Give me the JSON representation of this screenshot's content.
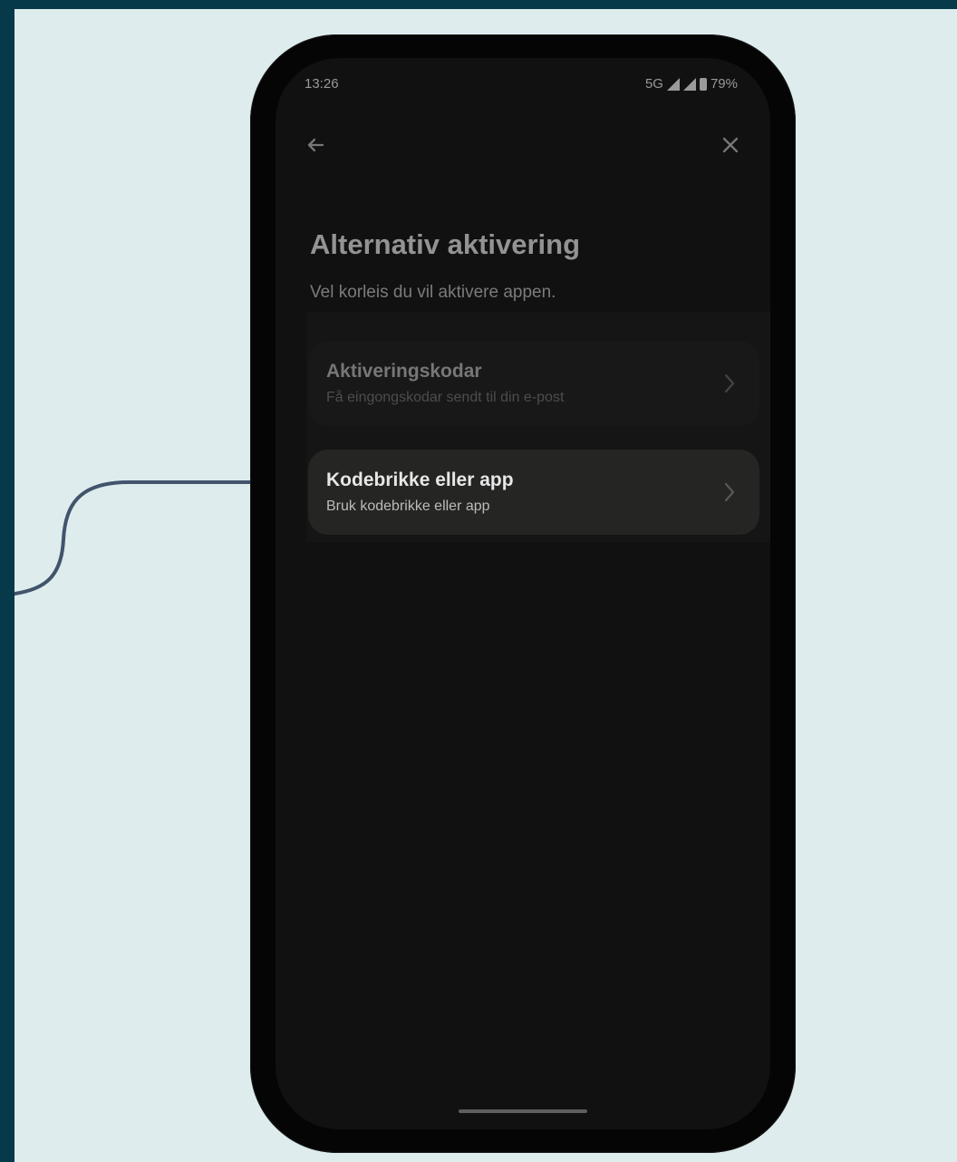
{
  "status_bar": {
    "time": "13:26",
    "network": "5G",
    "battery": "79%"
  },
  "navigation": {
    "back_icon": "arrow-left-icon",
    "close_icon": "close-icon"
  },
  "page": {
    "title": "Alternativ aktivering",
    "subtitle": "Vel korleis du vil aktivere appen."
  },
  "options": [
    {
      "title": "Aktiveringskodar",
      "description": "Få eingongskodar sendt til din e-post",
      "icon": "chevron-right-icon"
    },
    {
      "title": "Kodebrikke eller app",
      "description": "Bruk kodebrikke eller app",
      "icon": "chevron-right-icon"
    }
  ],
  "colors": {
    "outer_background": "#06394a",
    "canvas_background": "#deeced",
    "phone_screen": "#111111",
    "highlighted_option": "#252523",
    "callout": "#42546c"
  }
}
